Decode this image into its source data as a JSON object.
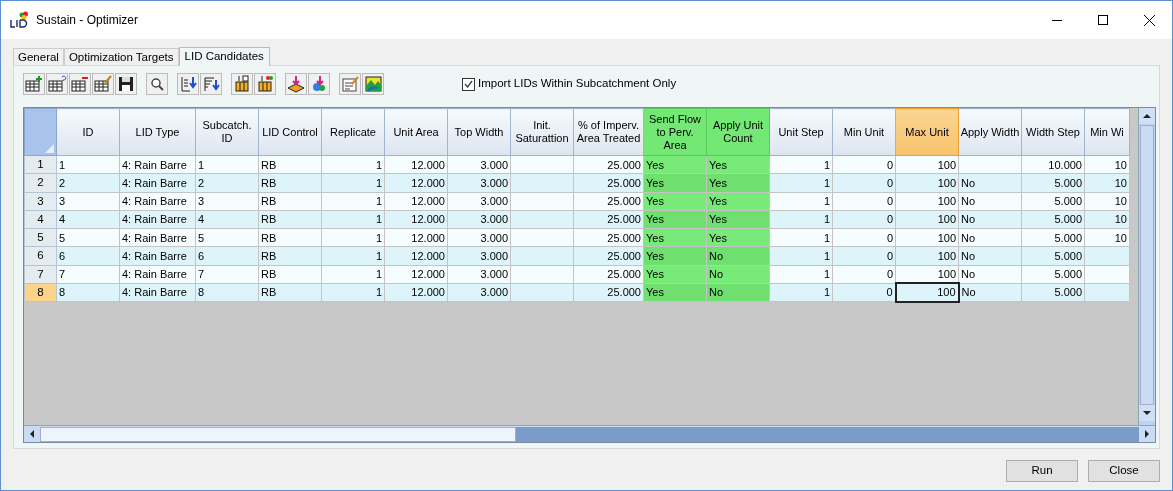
{
  "window": {
    "title": "Sustain - Optimizer"
  },
  "tabs": [
    {
      "label": "General",
      "selected": false
    },
    {
      "label": "Optimization Targets",
      "selected": false
    },
    {
      "label": "LID Candidates",
      "selected": true
    }
  ],
  "import_option": {
    "label": "Import LIDs Within Subcatchment Only",
    "checked": true
  },
  "table": {
    "columns": [
      {
        "label": "ID",
        "kind": "text",
        "selected": false,
        "highlighted": false
      },
      {
        "label": "LID Type",
        "kind": "text",
        "selected": false,
        "highlighted": false
      },
      {
        "label": "Subcatch. ID",
        "kind": "text",
        "selected": false,
        "highlighted": false
      },
      {
        "label": "LID Control",
        "kind": "text",
        "selected": false,
        "highlighted": false
      },
      {
        "label": "Replicate",
        "kind": "number",
        "selected": false,
        "highlighted": false
      },
      {
        "label": "Unit Area",
        "kind": "number",
        "selected": false,
        "highlighted": false
      },
      {
        "label": "Top Width",
        "kind": "number",
        "selected": false,
        "highlighted": false
      },
      {
        "label": "Init. Saturattion",
        "kind": "number",
        "selected": false,
        "highlighted": false
      },
      {
        "label": "% of Imperv. Area Treated",
        "kind": "number",
        "selected": false,
        "highlighted": false
      },
      {
        "label": "Send Flow to Perv. Area",
        "kind": "text",
        "selected": false,
        "highlighted": true
      },
      {
        "label": "Apply Unit Count",
        "kind": "text",
        "selected": false,
        "highlighted": true
      },
      {
        "label": "Unit Step",
        "kind": "number",
        "selected": false,
        "highlighted": false
      },
      {
        "label": "Min Unit",
        "kind": "number",
        "selected": false,
        "highlighted": false
      },
      {
        "label": "Max Unit",
        "kind": "number",
        "selected": true,
        "highlighted": false
      },
      {
        "label": "Apply Width",
        "kind": "text",
        "selected": false,
        "highlighted": false
      },
      {
        "label": "Width Step",
        "kind": "number",
        "selected": false,
        "highlighted": false
      },
      {
        "label": "Min Wi",
        "kind": "number",
        "selected": false,
        "highlighted": false
      }
    ],
    "rows": [
      {
        "number": "1",
        "selected": false,
        "cells": [
          "1",
          "4: Rain Barre",
          "1",
          "RB",
          "1",
          "12.000",
          "3.000",
          "",
          "25.000",
          "Yes",
          "Yes",
          "1",
          "0",
          "100",
          "",
          "10.000",
          "10"
        ]
      },
      {
        "number": "2",
        "selected": false,
        "cells": [
          "2",
          "4: Rain Barre",
          "2",
          "RB",
          "1",
          "12.000",
          "3.000",
          "",
          "25.000",
          "Yes",
          "Yes",
          "1",
          "0",
          "100",
          "No",
          "5.000",
          "10"
        ]
      },
      {
        "number": "3",
        "selected": false,
        "cells": [
          "3",
          "4: Rain Barre",
          "3",
          "RB",
          "1",
          "12.000",
          "3.000",
          "",
          "25.000",
          "Yes",
          "Yes",
          "1",
          "0",
          "100",
          "No",
          "5.000",
          "10"
        ]
      },
      {
        "number": "4",
        "selected": false,
        "cells": [
          "4",
          "4: Rain Barre",
          "4",
          "RB",
          "1",
          "12.000",
          "3.000",
          "",
          "25.000",
          "Yes",
          "Yes",
          "1",
          "0",
          "100",
          "No",
          "5.000",
          "10"
        ]
      },
      {
        "number": "5",
        "selected": false,
        "cells": [
          "5",
          "4: Rain Barre",
          "5",
          "RB",
          "1",
          "12.000",
          "3.000",
          "",
          "25.000",
          "Yes",
          "Yes",
          "1",
          "0",
          "100",
          "No",
          "5.000",
          "10"
        ]
      },
      {
        "number": "6",
        "selected": false,
        "cells": [
          "6",
          "4: Rain Barre",
          "6",
          "RB",
          "1",
          "12.000",
          "3.000",
          "",
          "25.000",
          "Yes",
          "No",
          "1",
          "0",
          "100",
          "No",
          "5.000",
          ""
        ]
      },
      {
        "number": "7",
        "selected": false,
        "cells": [
          "7",
          "4: Rain Barre",
          "7",
          "RB",
          "1",
          "12.000",
          "3.000",
          "",
          "25.000",
          "Yes",
          "No",
          "1",
          "0",
          "100",
          "No",
          "5.000",
          ""
        ]
      },
      {
        "number": "8",
        "selected": true,
        "cells": [
          "8",
          "4: Rain Barre",
          "8",
          "RB",
          "1",
          "12.000",
          "3.000",
          "",
          "25.000",
          "Yes",
          "No",
          "1",
          "0",
          "100",
          "No",
          "5.000",
          ""
        ]
      }
    ]
  },
  "buttons": [
    {
      "label": "Run"
    },
    {
      "label": "Close"
    }
  ]
}
